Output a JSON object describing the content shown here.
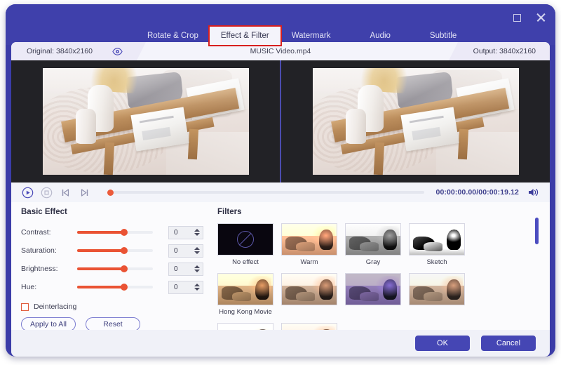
{
  "window": {
    "maximize_icon": "maximize-icon",
    "close_icon": "close-icon"
  },
  "tabs": [
    {
      "label": "Rotate & Crop",
      "active": false
    },
    {
      "label": "Effect & Filter",
      "active": true
    },
    {
      "label": "Watermark",
      "active": false
    },
    {
      "label": "Audio",
      "active": false
    },
    {
      "label": "Subtitle",
      "active": false
    }
  ],
  "filebar": {
    "original_label": "Original: 3840x2160",
    "eye_icon": "eye-icon",
    "filename": "MUSIC Video.mp4",
    "output_label": "Output: 3840x2160"
  },
  "transport": {
    "play_icon": "play-icon",
    "stop_icon": "stop-icon",
    "prev_frame_icon": "previous-frame-icon",
    "next_frame_icon": "next-frame-icon",
    "volume_icon": "volume-icon",
    "timecode": "00:00:00.00/00:00:19.12",
    "playhead_percent": 0
  },
  "basic_effect": {
    "title": "Basic Effect",
    "sliders": [
      {
        "label": "Contrast:",
        "value": "0",
        "percent": 62
      },
      {
        "label": "Saturation:",
        "value": "0",
        "percent": 62
      },
      {
        "label": "Brightness:",
        "value": "0",
        "percent": 62
      },
      {
        "label": "Hue:",
        "value": "0",
        "percent": 62
      }
    ],
    "deinterlacing_label": "Deinterlacing",
    "deinterlacing_checked": false,
    "apply_to_all_label": "Apply to All",
    "reset_label": "Reset"
  },
  "filters": {
    "title": "Filters",
    "items": [
      {
        "label": "No effect",
        "style": "none"
      },
      {
        "label": "Warm",
        "style": "warm"
      },
      {
        "label": "Gray",
        "style": "gray"
      },
      {
        "label": "Sketch",
        "style": "sketch"
      },
      {
        "label": "Hong Kong Movie",
        "style": "hk"
      },
      {
        "label": "",
        "style": "plain"
      },
      {
        "label": "",
        "style": "purple"
      },
      {
        "label": "",
        "style": "soft"
      },
      {
        "label": "",
        "style": "cool"
      },
      {
        "label": "",
        "style": "plain"
      }
    ]
  },
  "footer": {
    "ok_label": "OK",
    "cancel_label": "Cancel"
  },
  "colors": {
    "window_purple": "#3f40ab",
    "accent_slider": "#ea5334",
    "button_primary": "#4546b4",
    "highlight_red": "#d81f1f"
  }
}
